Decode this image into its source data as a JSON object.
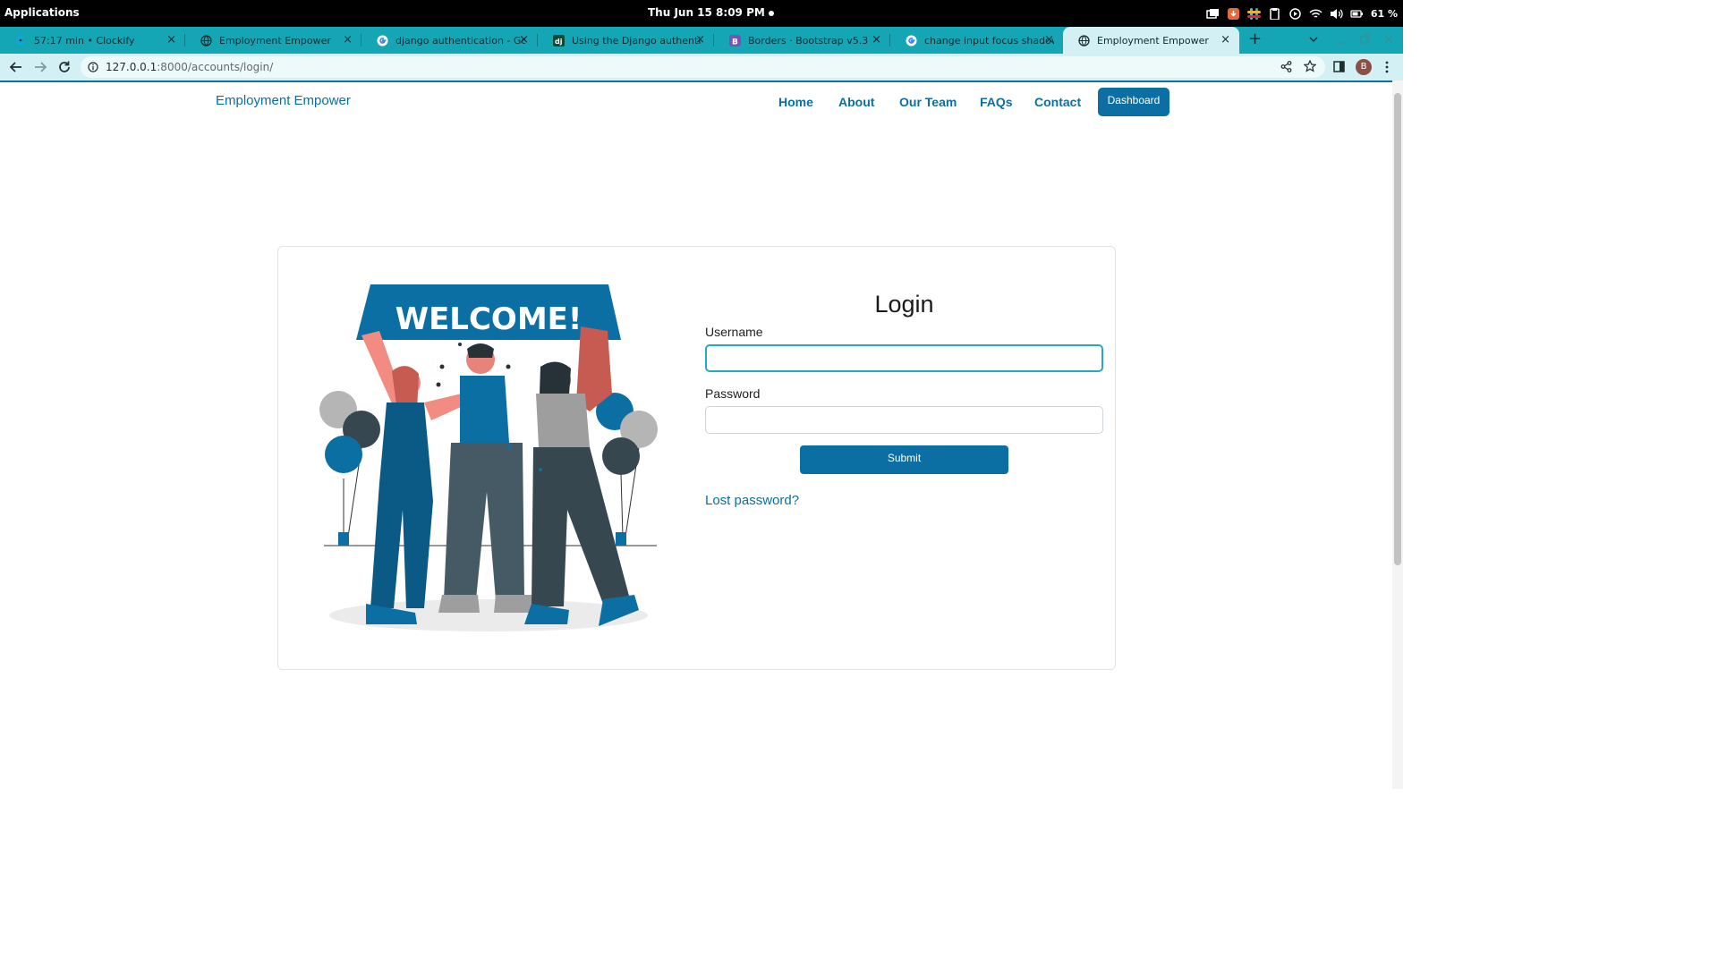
{
  "os": {
    "applications_label": "Applications",
    "clock": "Thu Jun 15   8:09 PM",
    "battery": "61 %"
  },
  "browser": {
    "tabs": [
      {
        "title": "57:17 min • Clockify",
        "icon": "clockify-icon"
      },
      {
        "title": "Employment Empower",
        "icon": "globe-icon"
      },
      {
        "title": "django authentication - Goog",
        "icon": "google-icon"
      },
      {
        "title": "Using the Django authenticat",
        "icon": "django-icon"
      },
      {
        "title": "Borders · Bootstrap v5.3",
        "icon": "bootstrap-icon"
      },
      {
        "title": "change input focus shadow c",
        "icon": "google-icon"
      },
      {
        "title": "Employment Empower",
        "icon": "globe-icon",
        "active": true
      }
    ],
    "url_host": "127.0.0.1",
    "url_path": ":8000/accounts/login/",
    "profile_initial": "B"
  },
  "site": {
    "brand": "Employment Empower",
    "nav": [
      "Home",
      "About",
      "Our Team",
      "FAQs",
      "Contact"
    ],
    "dashboard_label": "Dashboard"
  },
  "login": {
    "title": "Login",
    "username_label": "Username",
    "username_value": "",
    "password_label": "Password",
    "password_value": "",
    "submit_label": "Submit",
    "lost_password_label": "Lost password?",
    "illustration_text": "WELCOME!"
  },
  "colors": {
    "accent": "#0b6fa4",
    "tab_strip": "#14a6b4",
    "toolbar": "#d3f1f4",
    "focus_border": "#26a9c4"
  }
}
